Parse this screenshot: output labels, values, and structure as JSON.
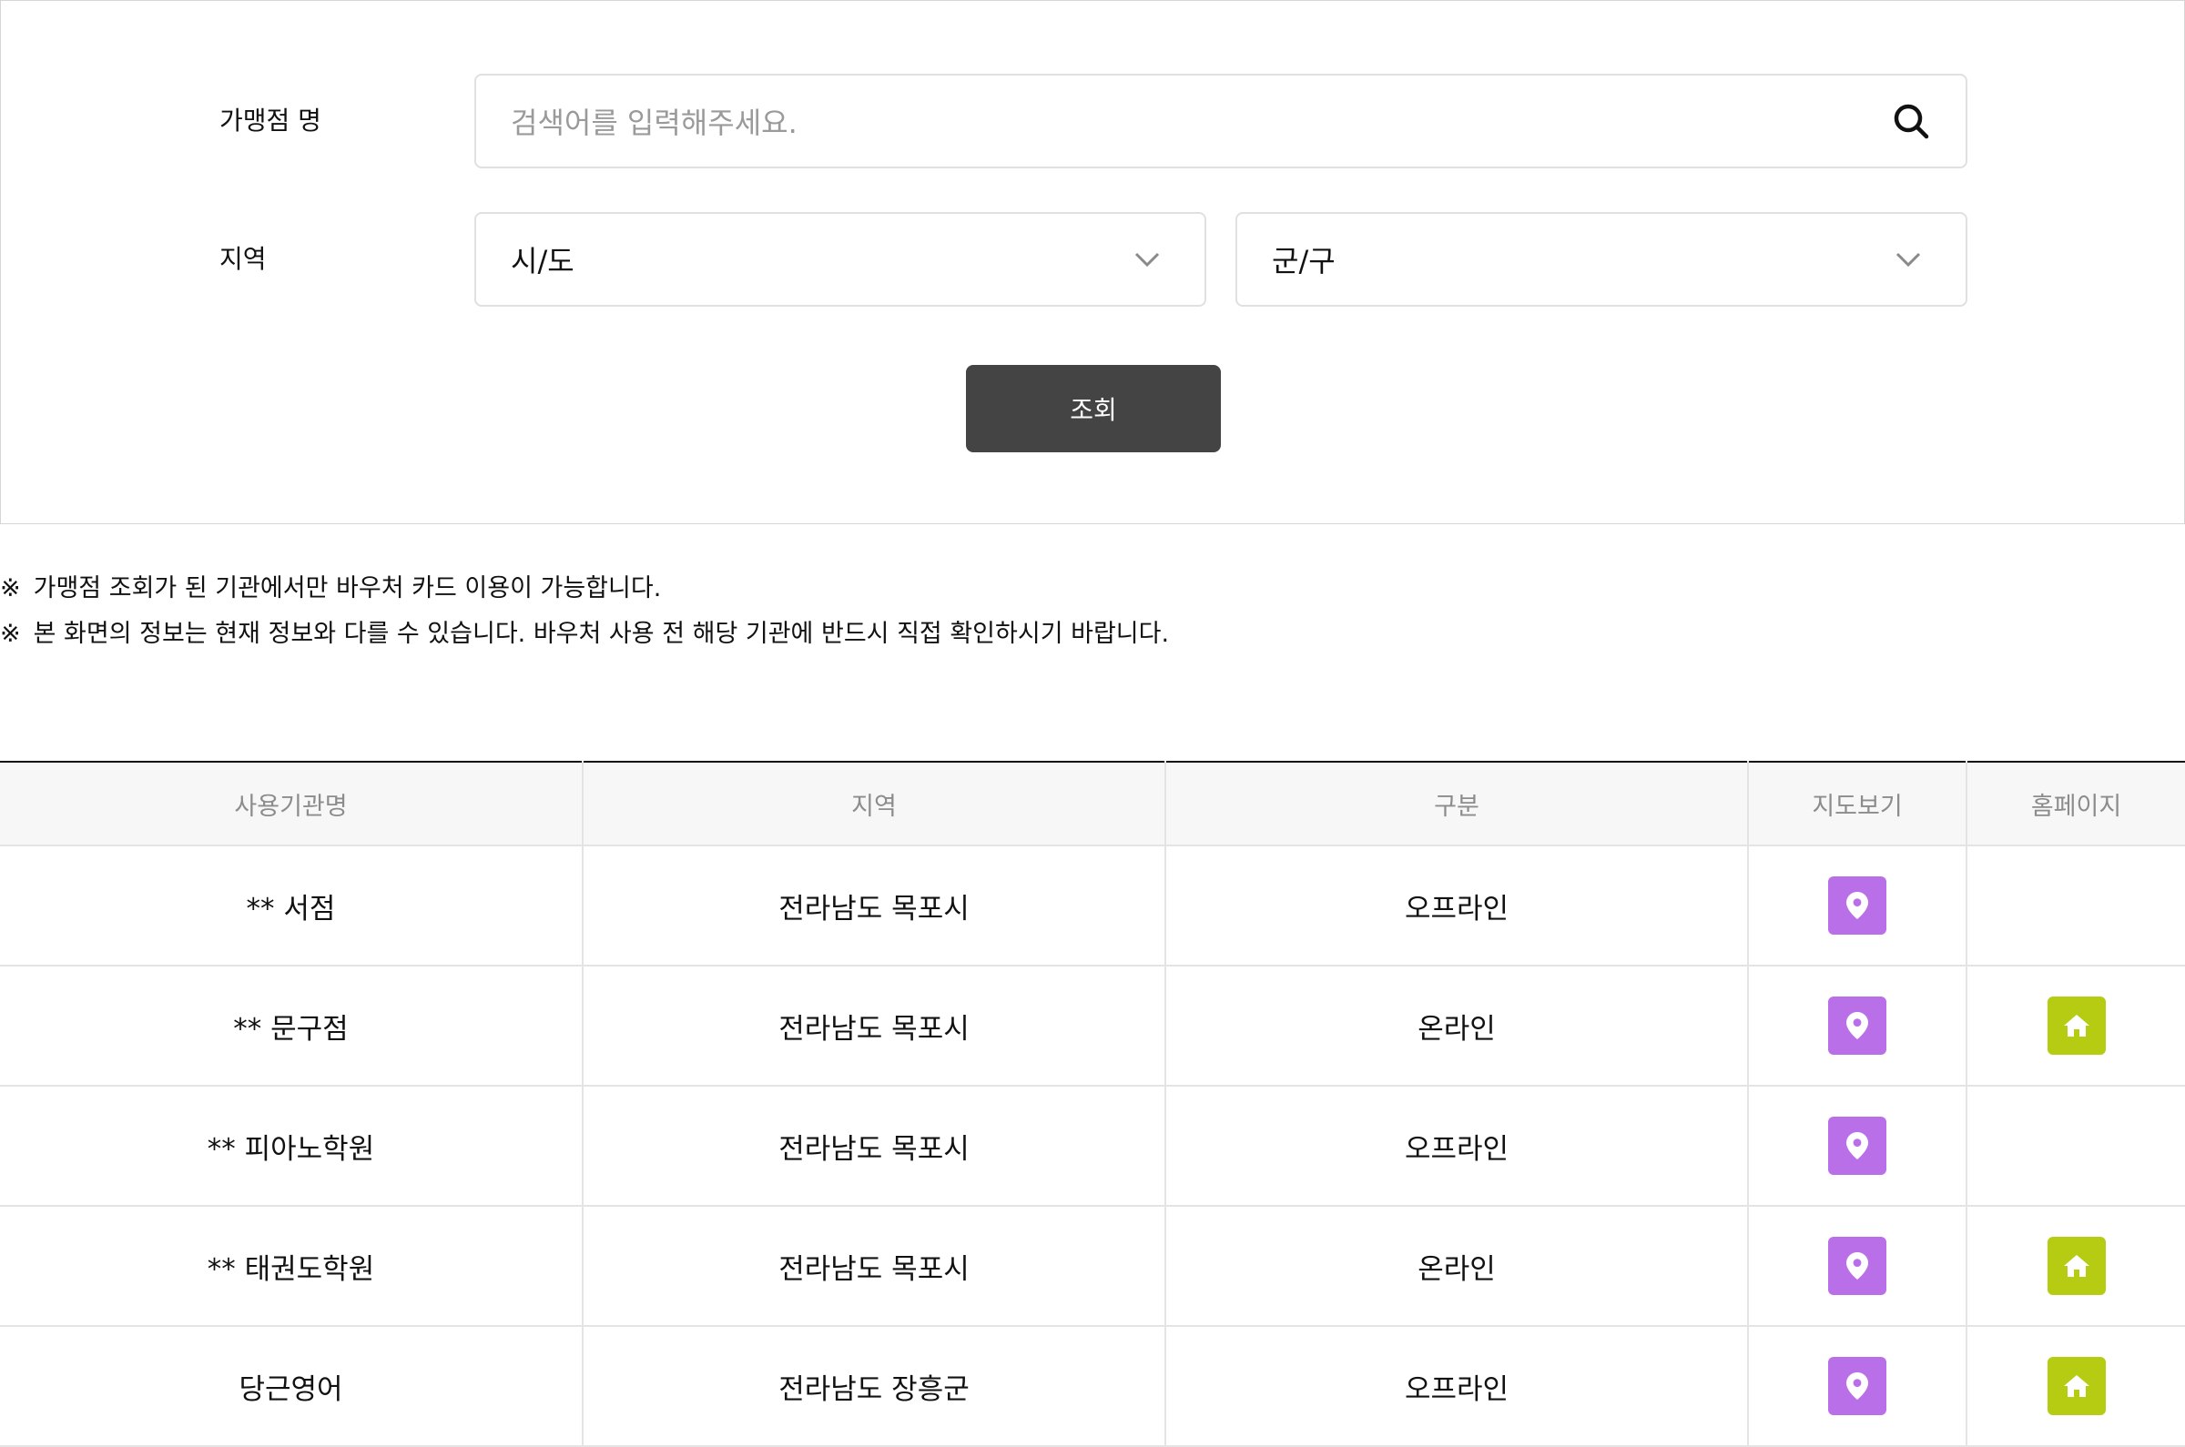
{
  "search": {
    "name_label": "가맹점 명",
    "name_placeholder": "검색어를 입력해주세요.",
    "region_label": "지역",
    "city_select": "시/도",
    "district_select": "군/구",
    "submit_label": "조회"
  },
  "notices": [
    "가맹점 조회가 된 기관에서만 바우처 카드 이용이 가능합니다.",
    "본 화면의 정보는 현재 정보와 다를 수 있습니다. 바우처 사용 전 해당 기관에 반드시 직접 확인하시기 바랍니다."
  ],
  "notice_mark": "※",
  "table": {
    "headers": [
      "사용기관명",
      "지역",
      "구분",
      "지도보기",
      "홈페이지"
    ],
    "rows": [
      {
        "name": "** 서점",
        "region": "전라남도 목포시",
        "type": "오프라인",
        "map": true,
        "homepage": false
      },
      {
        "name": "** 문구점",
        "region": "전라남도 목포시",
        "type": "온라인",
        "map": true,
        "homepage": true
      },
      {
        "name": "** 피아노학원",
        "region": "전라남도 목포시",
        "type": "오프라인",
        "map": true,
        "homepage": false
      },
      {
        "name": "** 태권도학원",
        "region": "전라남도 목포시",
        "type": "온라인",
        "map": true,
        "homepage": true
      },
      {
        "name": "당근영어",
        "region": "전라남도 장흥군",
        "type": "오프라인",
        "map": true,
        "homepage": true
      }
    ]
  },
  "icons": {
    "search": "search-icon",
    "dropdown": "chevron-down-icon",
    "map": "map-pin-icon",
    "homepage": "home-icon"
  },
  "colors": {
    "submit_button": "#444444",
    "map_button": "#b96fe8",
    "homepage_button": "#b5cc13",
    "table_top_border": "#111111"
  }
}
